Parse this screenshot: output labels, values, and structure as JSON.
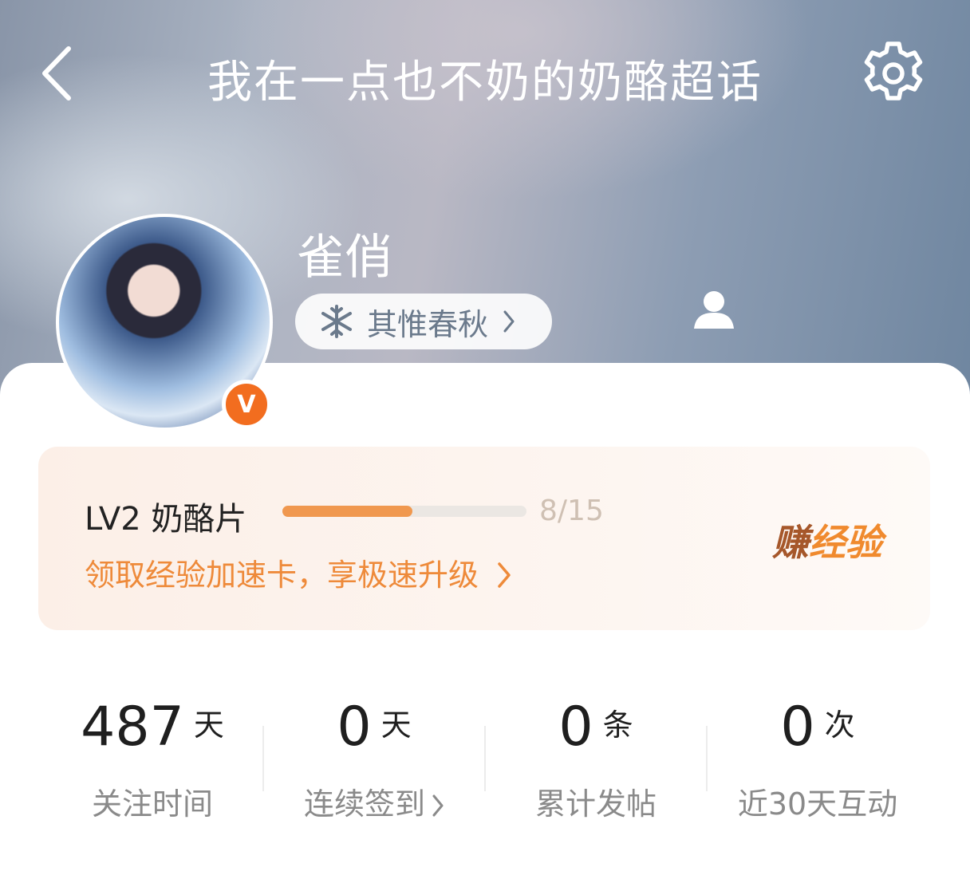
{
  "header": {
    "title": "我在一点也不奶的奶酪超话"
  },
  "profile": {
    "username": "雀俏",
    "tag": {
      "label": "其惟春秋"
    },
    "verified_badge": "V"
  },
  "level": {
    "title": "LV2 奶酪片",
    "progress_current": 8,
    "progress_total": 15,
    "progress_text": "8/15",
    "boost_link": "领取经验加速卡，享极速升级",
    "earn_part1": "赚",
    "earn_part2": "经验"
  },
  "stats": [
    {
      "value": "487",
      "unit": "天",
      "label": "关注时间"
    },
    {
      "value": "0",
      "unit": "天",
      "label": "连续签到"
    },
    {
      "value": "0",
      "unit": "条",
      "label": "累计发帖"
    },
    {
      "value": "0",
      "unit": "次",
      "label": "近30天互动"
    }
  ],
  "colors": {
    "accent": "#ee8a3a",
    "progress_fill": "#f0984f",
    "badge": "#f26d1f"
  }
}
